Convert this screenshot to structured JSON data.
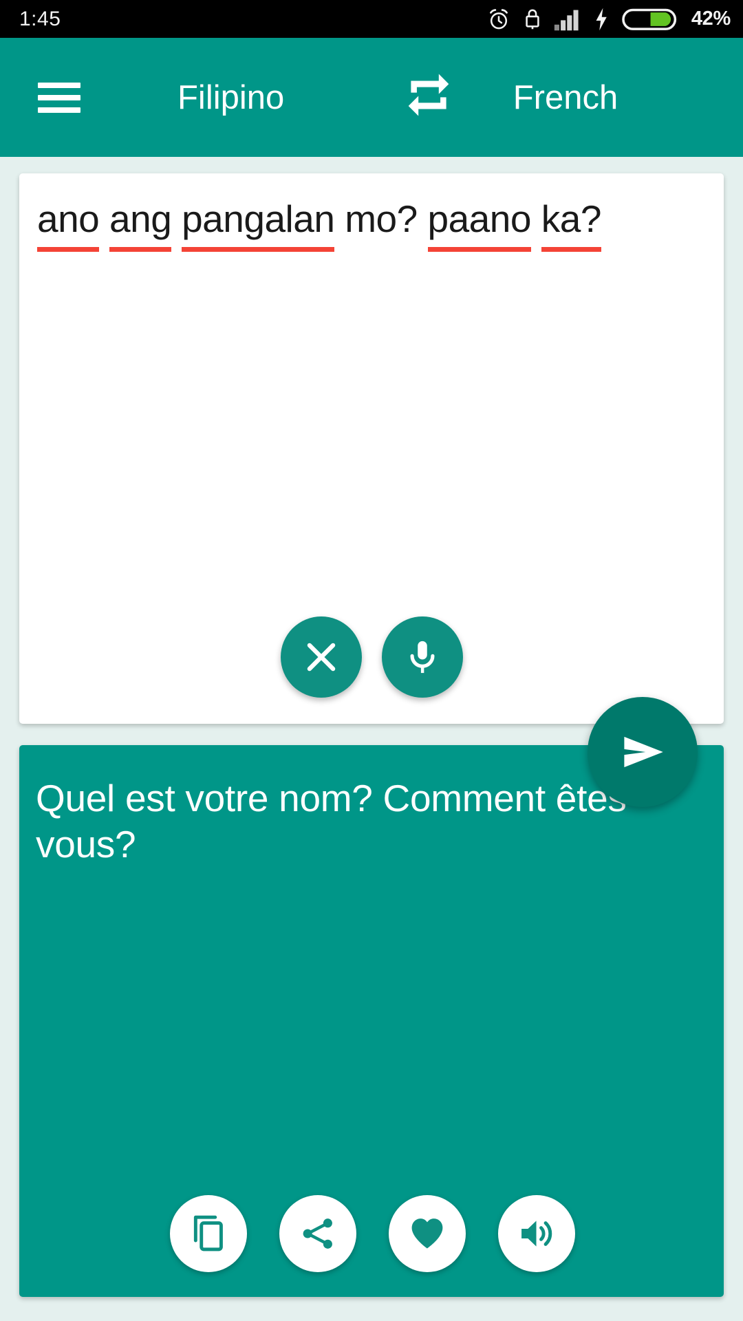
{
  "status_bar": {
    "time": "1:45",
    "battery_percent": "42%",
    "icons": [
      "alarm-icon",
      "screen-lock-icon",
      "signal-bars-icon",
      "charging-bolt-icon",
      "battery-icon"
    ],
    "battery_level": 42,
    "battery_fill_color": "#62c422",
    "background_color": "#000000",
    "text_color": "#f2f2f2"
  },
  "app_bar": {
    "menu_icon": "hamburger-menu-icon",
    "source_language": "Filipino",
    "swap_icon": "swap-languages-icon",
    "target_language": "French",
    "background_color": "#009688",
    "text_color": "#ffffff"
  },
  "input_card": {
    "text": "ano ang pangalan mo? paano ka?",
    "words": [
      {
        "text": "ano",
        "misspelled": true
      },
      {
        "text": "ang",
        "misspelled": true
      },
      {
        "text": "pangalan",
        "misspelled": true
      },
      {
        "text": "mo?",
        "misspelled": false
      },
      {
        "text": "paano",
        "misspelled": true
      },
      {
        "text": "ka?",
        "misspelled": true
      }
    ],
    "spellcheck_underline_color": "#f44336",
    "background_color": "#ffffff",
    "text_color": "#1a1a1a",
    "actions": [
      {
        "name": "clear-button",
        "icon": "close-x-icon",
        "label": "Clear"
      },
      {
        "name": "voice-input-button",
        "icon": "microphone-icon",
        "label": "Voice input"
      }
    ]
  },
  "send_button": {
    "icon": "send-arrow-icon",
    "label": "Translate",
    "color": "#00796b"
  },
  "output_card": {
    "text": "Quel est votre nom? Comment êtes-vous?",
    "background_color": "#009688",
    "text_color": "#ffffff",
    "actions": [
      {
        "name": "copy-button",
        "icon": "copy-icon",
        "label": "Copy"
      },
      {
        "name": "share-button",
        "icon": "share-icon",
        "label": "Share"
      },
      {
        "name": "favorite-button",
        "icon": "heart-icon",
        "label": "Favorite"
      },
      {
        "name": "speak-button",
        "icon": "speaker-volume-icon",
        "label": "Listen"
      }
    ]
  },
  "page": {
    "background_color": "#e4f0ee"
  }
}
